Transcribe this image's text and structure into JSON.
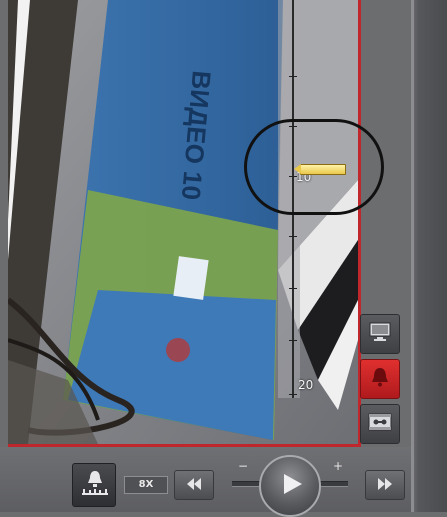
{
  "timeline": {
    "labels": {
      "mark_10": "10",
      "mark_20": "20"
    },
    "position_value": 10
  },
  "controls": {
    "speed": "8X",
    "minus": "−",
    "plus": "+"
  },
  "colors": {
    "accent_red": "#c0272d",
    "pointer_yellow": "#e9c84a",
    "panel_gray": "#6c6d6f"
  },
  "icons": {
    "side": [
      "monitor-icon",
      "bell-icon",
      "tape-archive-icon"
    ],
    "bottom": [
      "bell-scale-icon",
      "rewind-icon",
      "play-icon",
      "fast-forward-icon"
    ]
  },
  "video": {
    "wall_text": "ВИДЕО 10"
  }
}
